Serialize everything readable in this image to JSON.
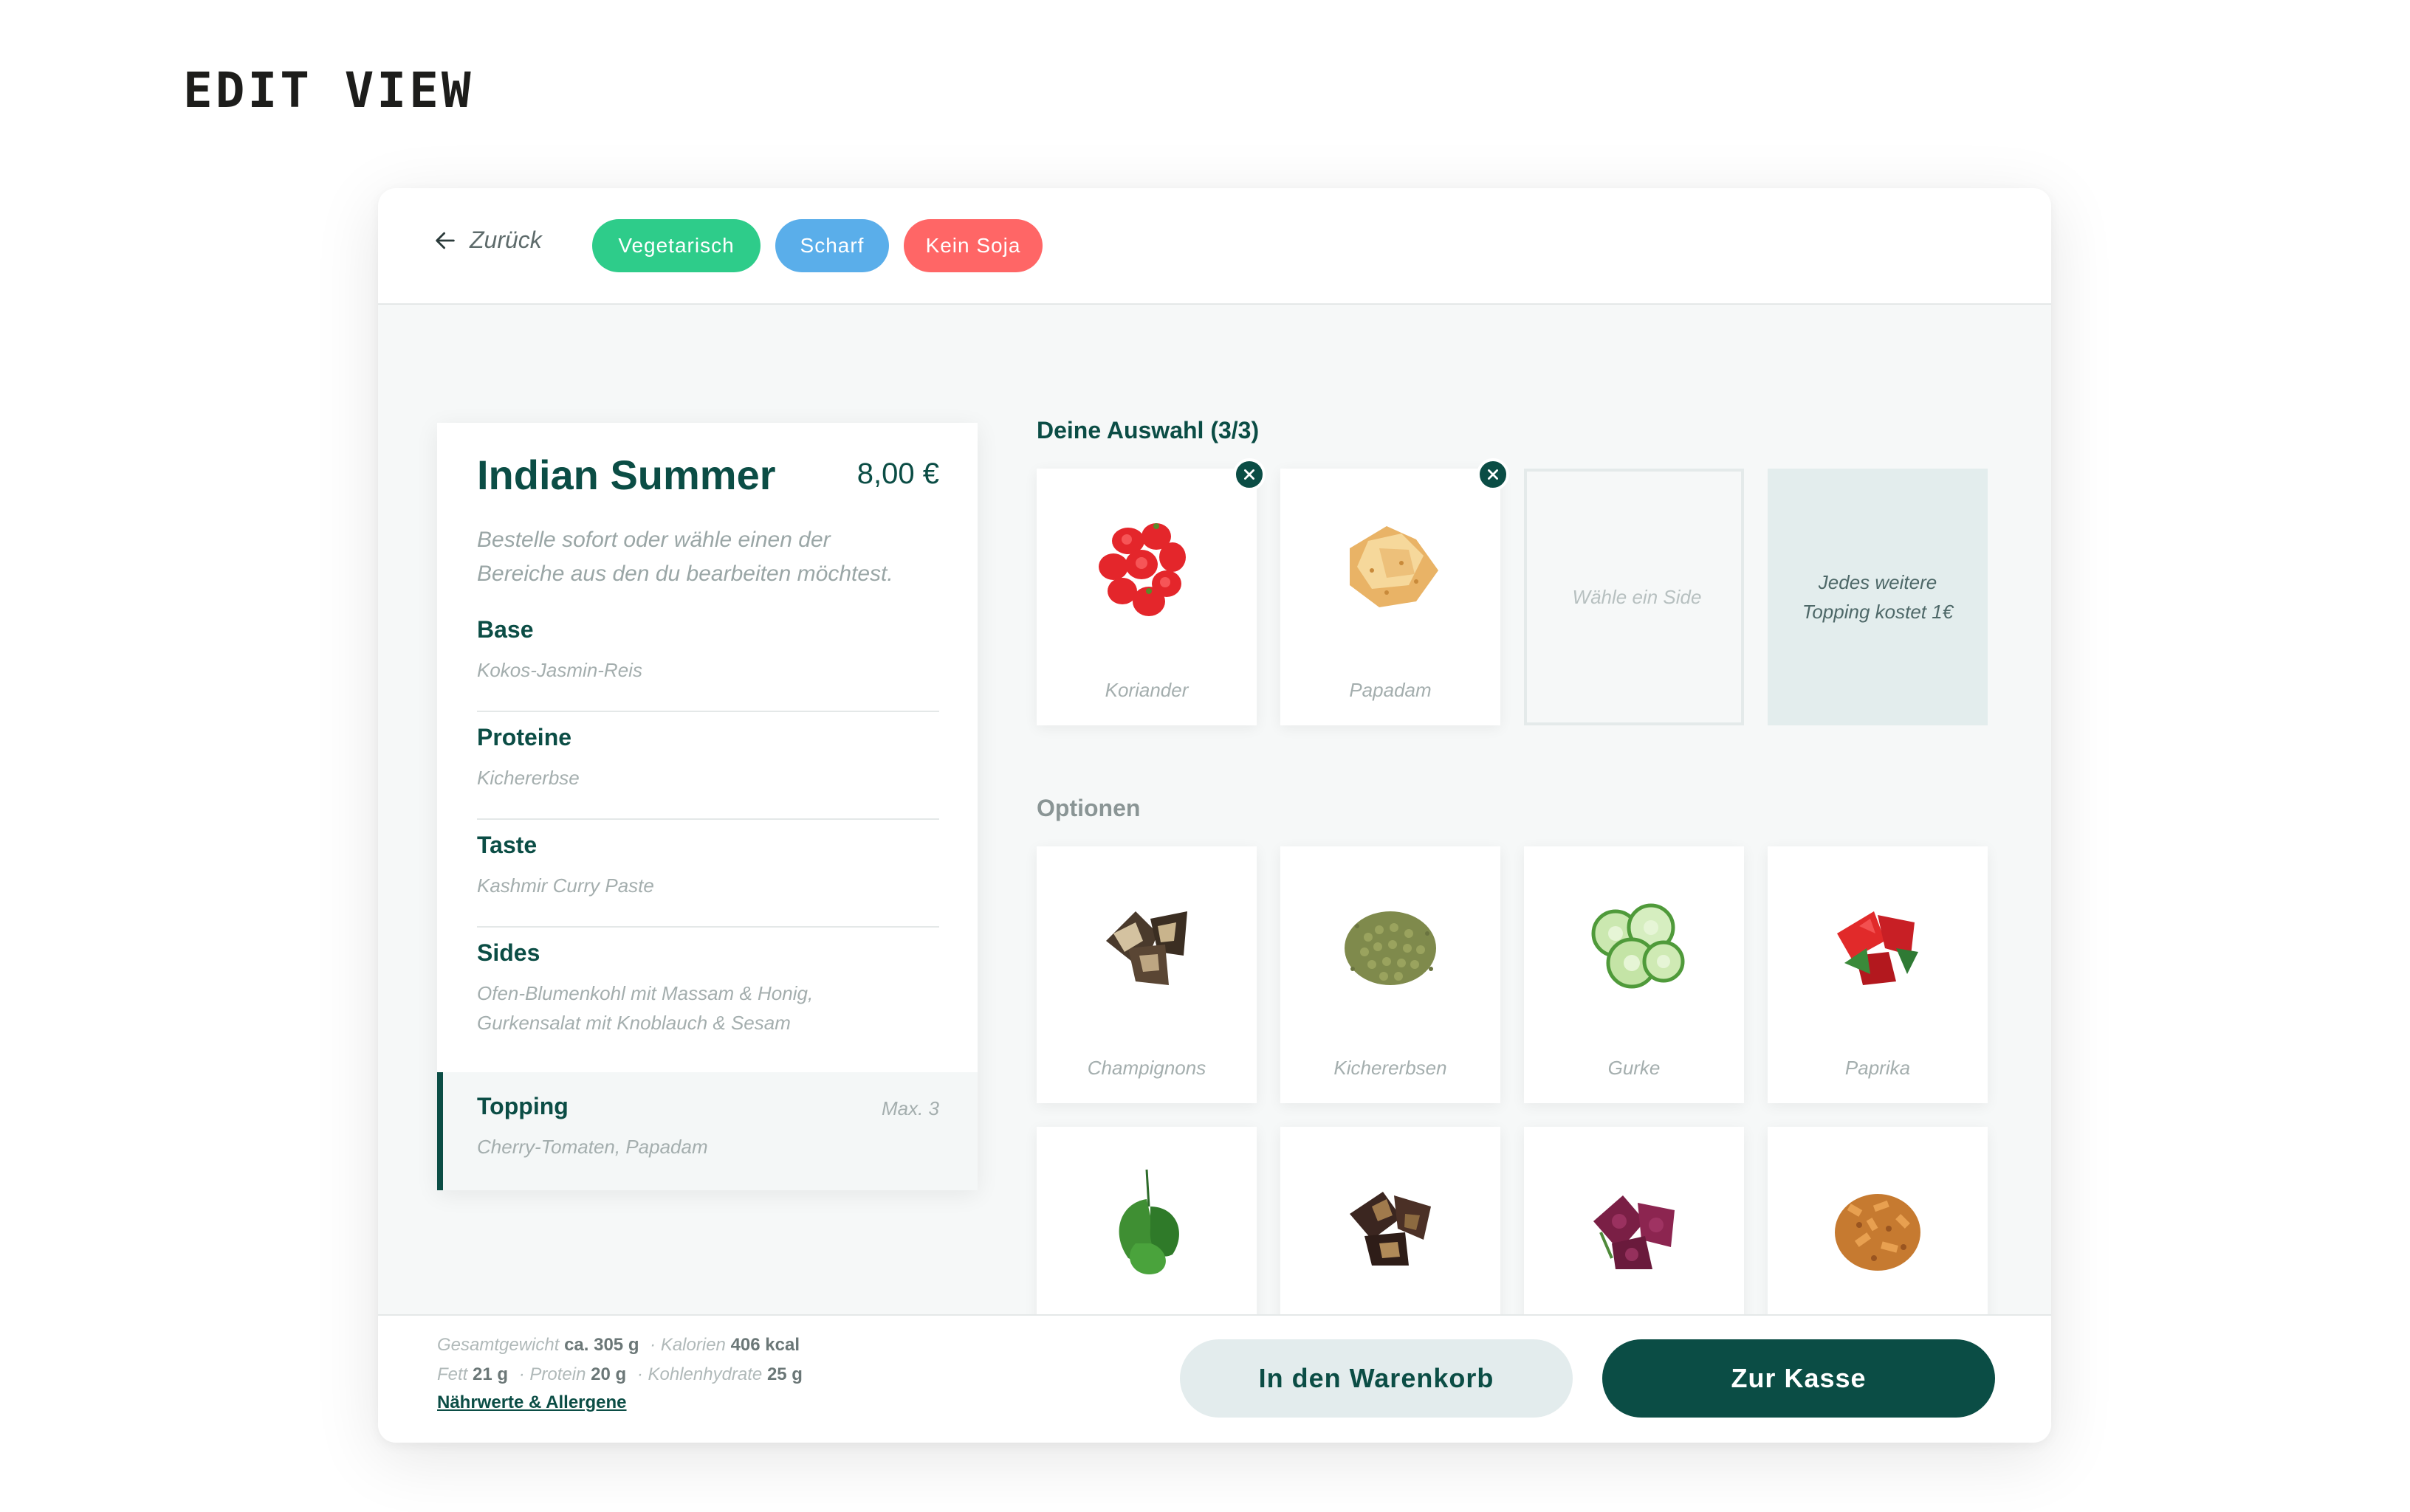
{
  "page": {
    "title": "EDIT VIEW"
  },
  "header": {
    "back_label": "Zurück",
    "tags": [
      {
        "label": "Vegetarisch",
        "color": "#2ecc8a"
      },
      {
        "label": "Scharf",
        "color": "#5aaeea"
      },
      {
        "label": "Kein Soja",
        "color": "#ff6666"
      }
    ]
  },
  "summary": {
    "title": "Indian Summer",
    "price": "8,00 €",
    "description": "Bestelle sofort oder wähle einen der Bereiche aus den du bearbeiten möchtest.",
    "sections": [
      {
        "title": "Base",
        "value": "Kokos-Jasmin-Reis"
      },
      {
        "title": "Proteine",
        "value": "Kichererbse"
      },
      {
        "title": "Taste",
        "value": "Kashmir Curry Paste"
      },
      {
        "title": "Sides",
        "value": "Ofen-Blumenkohl mit Massam & Honig, Gurkensalat mit Knoblauch & Sesam"
      }
    ],
    "topping": {
      "title": "Topping",
      "value": "Cherry-Tomaten, Papadam",
      "max": "Max. 3"
    }
  },
  "selection": {
    "heading": "Deine Auswahl (3/3)",
    "items": [
      {
        "label": "Koriander",
        "icon": "tomato-image"
      },
      {
        "label": "Papadam",
        "icon": "papadam-image"
      }
    ],
    "empty_label": "Wähle ein Side",
    "info_label": "Jedes weitere Topping kostet 1€"
  },
  "options": {
    "heading": "Optionen",
    "items": [
      {
        "label": "Champignons",
        "icon": "mushroom-image"
      },
      {
        "label": "Kichererbsen",
        "icon": "chickpeas-image"
      },
      {
        "label": "Gurke",
        "icon": "cucumber-image"
      },
      {
        "label": "Paprika",
        "icon": "paprika-image"
      },
      {
        "label": "",
        "icon": "spinach-image"
      },
      {
        "label": "",
        "icon": "eggplant-image"
      },
      {
        "label": "",
        "icon": "beetroot-image"
      },
      {
        "label": "",
        "icon": "crispy-onion-image"
      }
    ]
  },
  "footer": {
    "weight_label": "Gesamtgewicht",
    "weight_value": "ca. 305 g",
    "calories_label": "Kalorien",
    "calories_value": "406 kcal",
    "fat_label": "Fett",
    "fat_value": "21 g",
    "protein_label": "Protein",
    "protein_value": "20 g",
    "carbs_label": "Kohlenhydrate",
    "carbs_value": "25 g",
    "link": "Nährwerte & Allergene",
    "cart_button": "In den Warenkorb",
    "checkout_button": "Zur Kasse"
  },
  "colors": {
    "brand": "#0b4d45",
    "background": "#f6f8f8"
  }
}
